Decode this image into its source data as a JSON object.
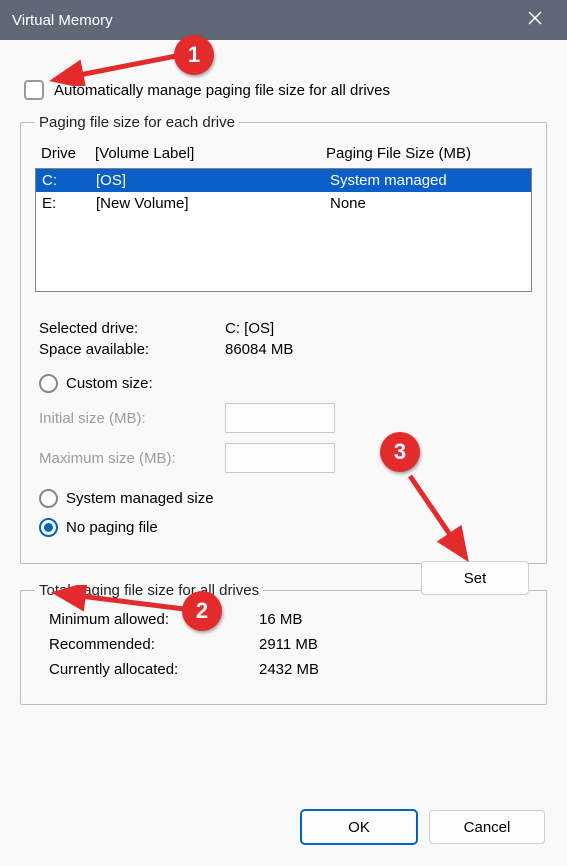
{
  "window": {
    "title": "Virtual Memory"
  },
  "auto_manage_label": "Automatically manage paging file size for all drives",
  "auto_manage_checked": false,
  "groupbox_drives_legend": "Paging file size for each drive",
  "drive_table": {
    "headers": {
      "drive": "Drive",
      "volume": "[Volume Label]",
      "size": "Paging File Size (MB)"
    },
    "rows": [
      {
        "drive": "C:",
        "volume": "[OS]",
        "size": "System managed",
        "selected": true
      },
      {
        "drive": "E:",
        "volume": "[New Volume]",
        "size": "None",
        "selected": false
      }
    ]
  },
  "selected_info": {
    "selected_drive_label": "Selected drive:",
    "selected_drive_value": "C:  [OS]",
    "space_available_label": "Space available:",
    "space_available_value": "86084 MB"
  },
  "size_options": {
    "custom_size_label": "Custom size:",
    "initial_size_label": "Initial size (MB):",
    "maximum_size_label": "Maximum size (MB):",
    "system_managed_label": "System managed size",
    "no_paging_label": "No paging file",
    "selected": "no_paging",
    "set_button_label": "Set"
  },
  "groupbox_totals_legend": "Total paging file size for all drives",
  "totals": {
    "minimum_label": "Minimum allowed:",
    "minimum_value": "16 MB",
    "recommended_label": "Recommended:",
    "recommended_value": "2911 MB",
    "allocated_label": "Currently allocated:",
    "allocated_value": "2432 MB"
  },
  "footer": {
    "ok_label": "OK",
    "cancel_label": "Cancel"
  },
  "annotations": {
    "callout1": "1",
    "callout2": "2",
    "callout3": "3"
  }
}
